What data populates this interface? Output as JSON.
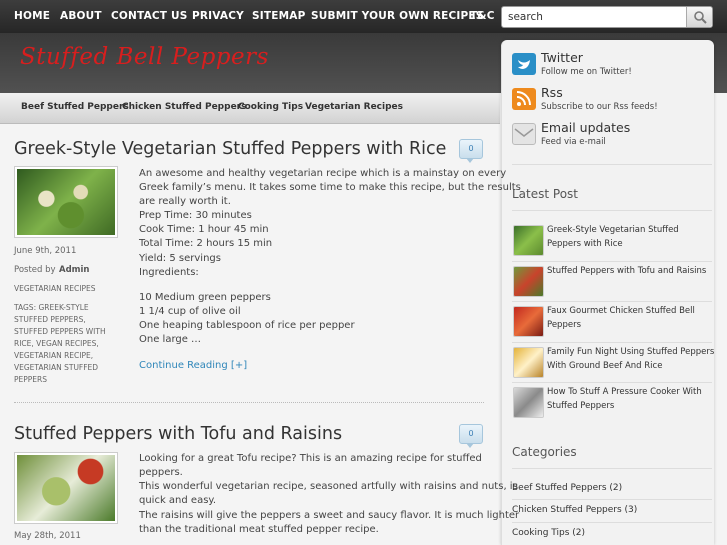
{
  "nav": {
    "items": [
      "HOME",
      "ABOUT",
      "CONTACT US",
      "PRIVACY",
      "SITEMAP",
      "SUBMIT YOUR OWN RECIPES",
      "T&C"
    ],
    "search_placeholder": "search"
  },
  "site": {
    "title": "Stuffed Bell Peppers"
  },
  "categories_nav": [
    "Beef Stuffed Peppers",
    "Chicken Stuffed Peppers",
    "Cooking Tips",
    "Vegetarian Recipes"
  ],
  "subscribe": [
    {
      "title": "Twitter",
      "desc": "Follow me on Twitter!",
      "icon": "twitter-icon",
      "color": "#2a8fc7"
    },
    {
      "title": "Rss",
      "desc": "Subscribe to our Rss feeds!",
      "icon": "rss-icon",
      "color": "#ee8a1d"
    },
    {
      "title": "Email updates",
      "desc": "Feed via e-mail",
      "icon": "email-icon",
      "color": "#cfcfcf"
    }
  ],
  "latest": {
    "heading": "Latest Post",
    "posts": [
      "Greek-Style Vegetarian Stuffed Peppers with Rice",
      "Stuffed Peppers with Tofu and Raisins",
      "Faux Gourmet Chicken Stuffed Bell Peppers",
      "Family Fun Night Using Stuffed Peppers With Ground Beef And Rice",
      "How To Stuff A Pressure Cooker With Stuffed Peppers"
    ]
  },
  "categories": {
    "heading": "Categories",
    "items": [
      "Beef Stuffed Peppers (2)",
      "Chicken Stuffed Peppers (3)",
      "Cooking Tips (2)"
    ]
  },
  "posts": [
    {
      "title": "Greek-Style Vegetarian Stuffed Peppers with Rice",
      "comments": "0",
      "date": "June 9th, 2011",
      "posted_by_label": "Posted by",
      "author": "Admin",
      "category": "VEGETARIAN RECIPES",
      "tags": "TAGS: GREEK-STYLE STUFFED PEPPERS, STUFFED PEPPERS WITH RICE, VEGAN RECIPES, VEGETARIAN RECIPE, VEGETARIAN STUFFED PEPPERS",
      "lines": [
        "An awesome and healthy vegetarian recipe which is a mainstay on every",
        "Greek family’s menu. It takes some time to make this recipe, but the results",
        "are really worth it.",
        "Prep Time: 30 minutes",
        "Cook Time: 1 hour 45 min",
        "Total Time: 2 hours 15 min",
        "Yield: 5 servings",
        "Ingredients:",
        "10 Medium green peppers",
        "1 1/4 cup of olive oil",
        "One heaping tablespoon of rice per pepper",
        "One large …"
      ],
      "continue": "Continue Reading [+]"
    },
    {
      "title": "Stuffed Peppers with Tofu and Raisins",
      "comments": "0",
      "date": "May 28th, 2011",
      "lines": [
        "Looking for a great Tofu recipe? This is an amazing recipe for stuffed",
        "peppers.",
        "This wonderful vegetarian recipe, seasoned artfully with raisins and nuts, is",
        "quick and easy.",
        "The raisins will give the peppers a sweet and saucy flavor. It is much lighter",
        "than the traditional meat stuffed pepper recipe."
      ]
    }
  ]
}
